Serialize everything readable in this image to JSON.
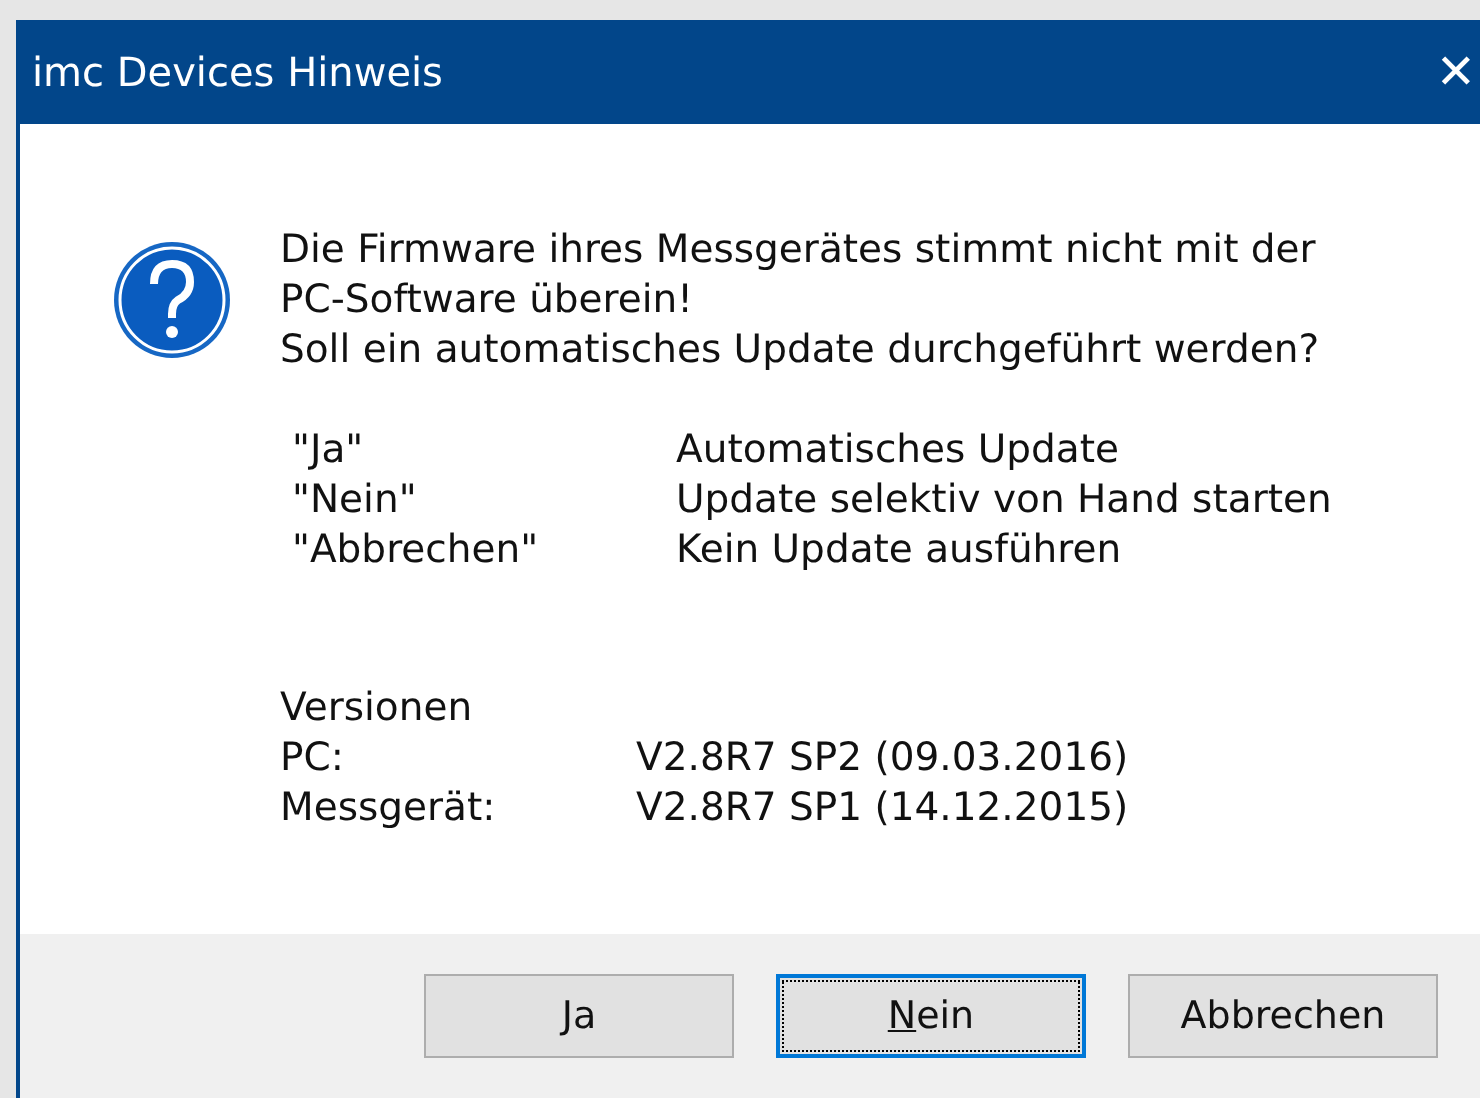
{
  "window": {
    "title": "imc Devices Hinweis",
    "close": "✕"
  },
  "message": {
    "lines": [
      "Die Firmware ihres Messgerätes stimmt nicht mit der",
      "PC-Software überein!",
      "Soll ein automatisches Update durchgeführt werden?"
    ]
  },
  "options": [
    {
      "key": "\"Ja\"",
      "description": "Automatisches Update"
    },
    {
      "key": "\"Nein\"",
      "description": "Update selektiv von Hand starten"
    },
    {
      "key": "\"Abbrechen\"",
      "description": "Kein Update ausführen"
    }
  ],
  "versions": {
    "heading": "Versionen",
    "rows": [
      {
        "label": "PC:",
        "value": "V2.8R7 SP2 (09.03.2016)"
      },
      {
        "label": "Messgerät:",
        "value": "V2.8R7 SP1 (14.12.2015)"
      }
    ]
  },
  "buttons": [
    {
      "access_key": "J",
      "rest": "a",
      "default": false
    },
    {
      "access_key": "N",
      "rest": "ein",
      "default": true
    },
    {
      "rest": "Abbrechen",
      "default": false
    }
  ]
}
